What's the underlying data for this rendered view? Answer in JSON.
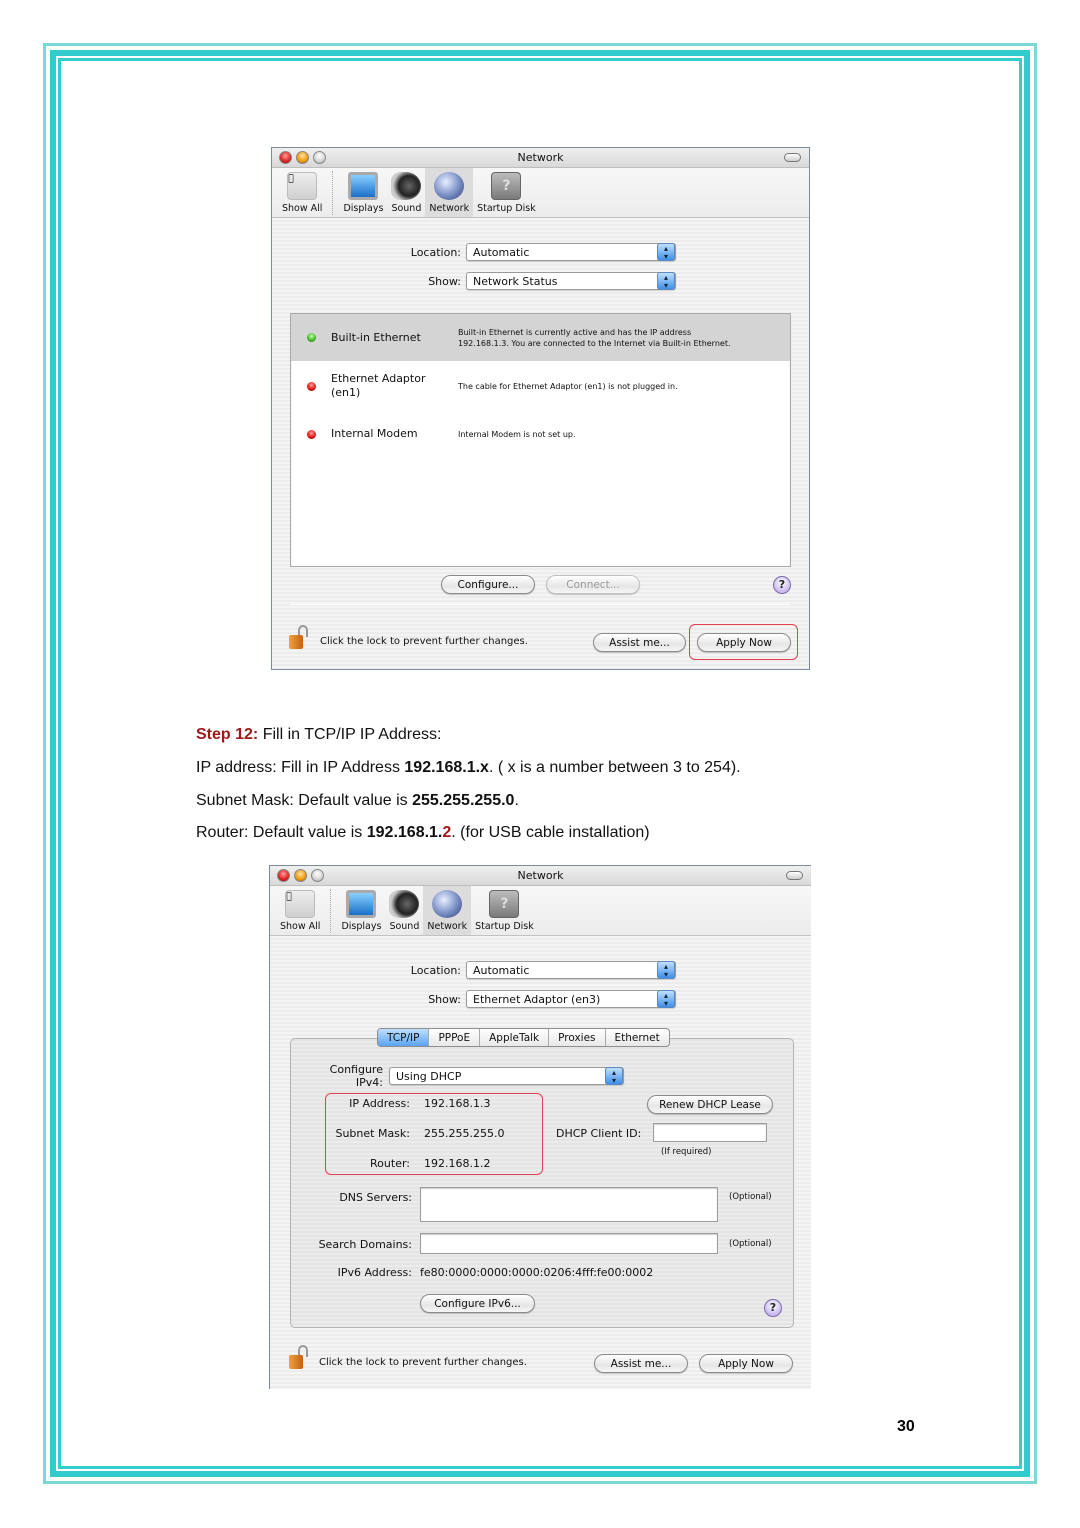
{
  "window1": {
    "title": "Network",
    "toolbar": [
      {
        "label": "Show All",
        "icon": "apple-show-all-icon"
      },
      {
        "label": "Displays",
        "icon": "display-icon"
      },
      {
        "label": "Sound",
        "icon": "speaker-icon"
      },
      {
        "label": "Network",
        "icon": "network-globe-icon",
        "selected": true
      },
      {
        "label": "Startup Disk",
        "icon": "startup-disk-icon"
      }
    ],
    "location_label": "Location:",
    "location_value": "Automatic",
    "show_label": "Show:",
    "show_value": "Network Status",
    "services": [
      {
        "name": "Built-in Ethernet",
        "status": "green",
        "desc": "Built-in Ethernet is currently active and has the IP address 192.168.1.3. You are connected to the Internet via Built-in Ethernet.",
        "selected": true
      },
      {
        "name": "Ethernet Adaptor (en1)",
        "status": "red",
        "desc": "The cable for Ethernet Adaptor (en1) is not plugged in."
      },
      {
        "name": "Internal Modem",
        "status": "red",
        "desc": "Internal Modem is not set up."
      }
    ],
    "configure_button": "Configure...",
    "connect_button": "Connect...",
    "help": "?",
    "lock_text": "Click the lock to prevent further changes.",
    "assist_button": "Assist me...",
    "apply_button": "Apply Now"
  },
  "instructions": {
    "step_label": "Step 12:",
    "step_text": " Fill in TCP/IP IP Address:",
    "ip_prefix": "IP address: Fill in IP Address ",
    "ip_value": "192.168.1.x",
    "ip_suffix": ". ( x is a number between 3 to 254).",
    "mask_prefix": "Subnet Mask: Default value is ",
    "mask_value": "255.255.255.0",
    "mask_suffix": ".",
    "router_prefix": "Router: Default value is ",
    "router_value_a": "192.168.1.",
    "router_value_b": "2",
    "router_suffix": ". (for USB cable installation)"
  },
  "window2": {
    "title": "Network",
    "toolbar": [
      {
        "label": "Show All"
      },
      {
        "label": "Displays"
      },
      {
        "label": "Sound"
      },
      {
        "label": "Network",
        "selected": true
      },
      {
        "label": "Startup Disk"
      }
    ],
    "location_label": "Location:",
    "location_value": "Automatic",
    "show_label": "Show:",
    "show_value": "Ethernet Adaptor (en3)",
    "tabs": [
      "TCP/IP",
      "PPPoE",
      "AppleTalk",
      "Proxies",
      "Ethernet"
    ],
    "active_tab": "TCP/IP",
    "configure_ipv4_label": "Configure IPv4:",
    "configure_ipv4_value": "Using DHCP",
    "ip_label": "IP Address:",
    "ip_value": "192.168.1.3",
    "mask_label": "Subnet Mask:",
    "mask_value": "255.255.255.0",
    "router_label": "Router:",
    "router_value": "192.168.1.2",
    "renew_button": "Renew DHCP Lease",
    "client_id_label": "DHCP Client ID:",
    "client_id_value": "",
    "client_id_hint": "(If required)",
    "dns_label": "DNS Servers:",
    "dns_value": "",
    "optional": "(Optional)",
    "search_label": "Search Domains:",
    "search_value": "",
    "ipv6_label": "IPv6 Address:",
    "ipv6_value": "fe80:0000:0000:0000:0206:4fff:fe00:0002",
    "configure_ipv6_button": "Configure IPv6...",
    "help": "?",
    "lock_text": "Click the lock to prevent further changes.",
    "assist_button": "Assist me...",
    "apply_button": "Apply Now"
  },
  "page_number": "30",
  "colors": {
    "border": "#33cccc",
    "step": "#a01818",
    "highlight": "#e04050"
  }
}
